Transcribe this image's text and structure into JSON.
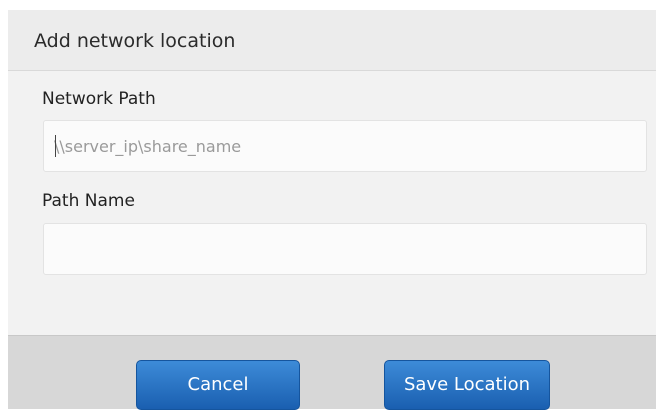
{
  "dialog": {
    "title": "Add network location",
    "network_path": {
      "label": "Network Path",
      "value": "",
      "placeholder": "\\\\server_ip\\share_name"
    },
    "path_name": {
      "label": "Path Name",
      "value": "",
      "placeholder": ""
    },
    "buttons": {
      "cancel": "Cancel",
      "save": "Save Location"
    }
  },
  "colors": {
    "button_blue": "#2a74c6",
    "dialog_bg": "#f2f2f2",
    "footer_bg": "#d7d7d7"
  }
}
